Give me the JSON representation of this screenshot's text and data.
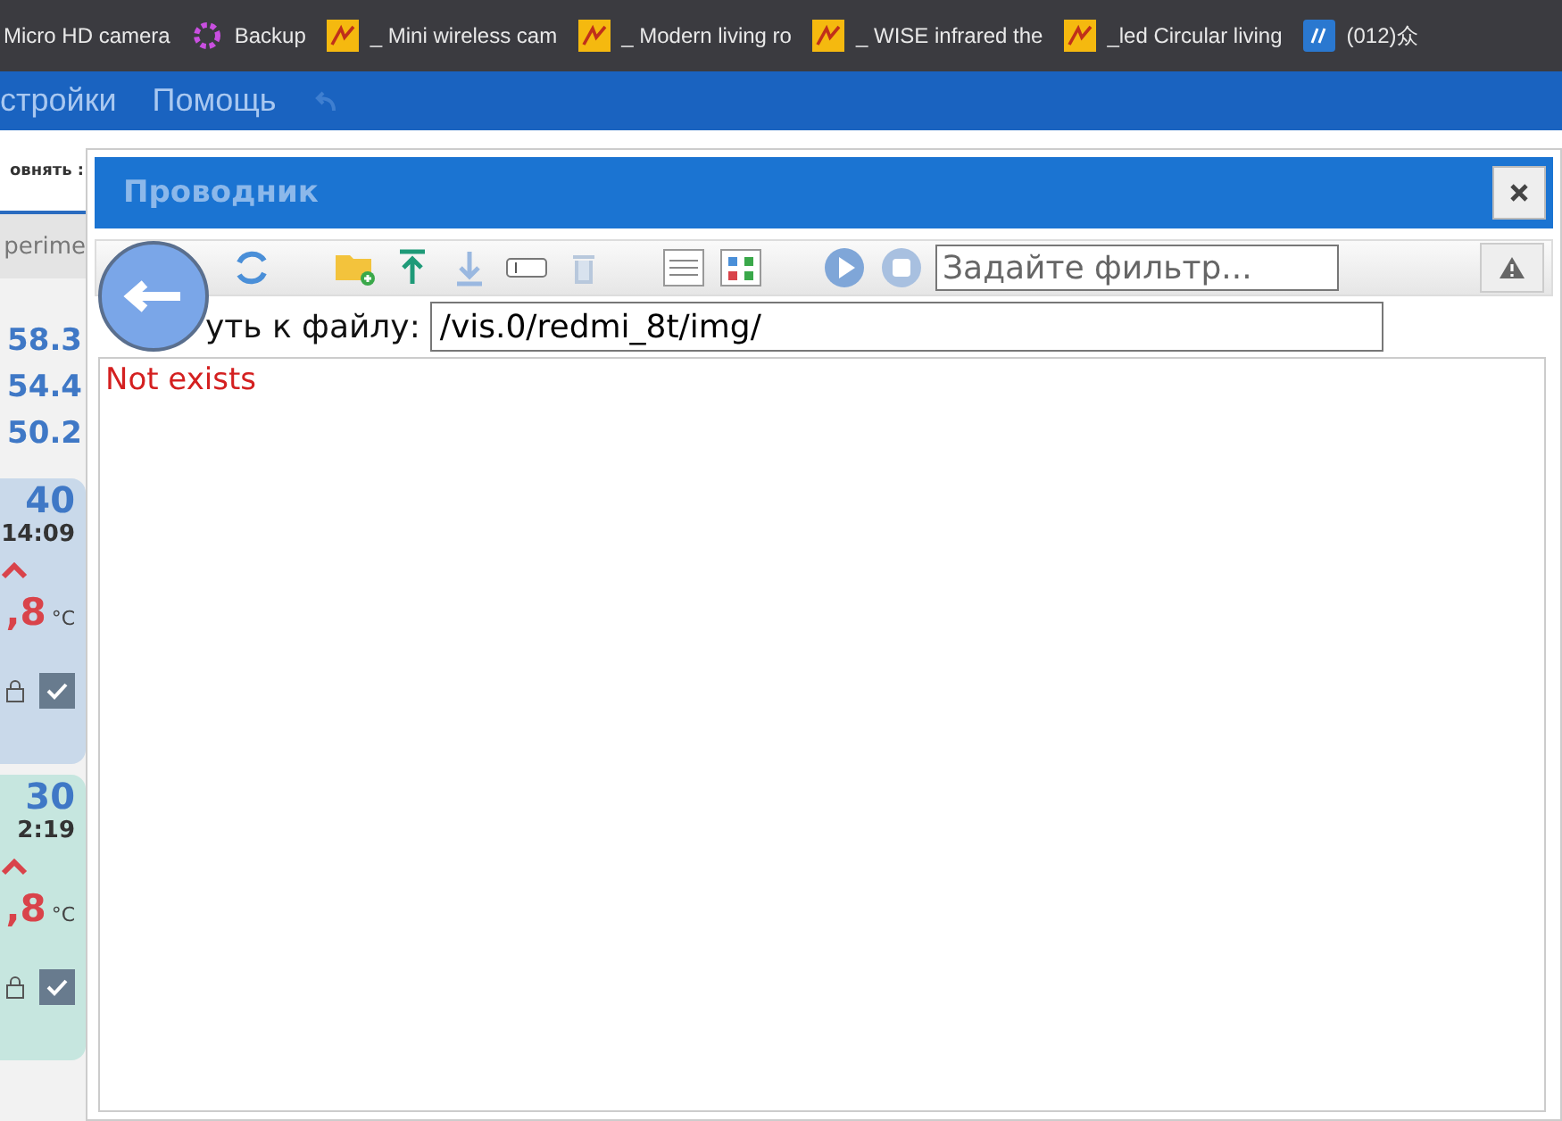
{
  "bookmarks": [
    {
      "label": "Micro HD camera"
    },
    {
      "label": "Backup"
    },
    {
      "label": "_ Mini wireless cam"
    },
    {
      "label": "_ Modern living ro"
    },
    {
      "label": "_ WISE infrared the"
    },
    {
      "label": "_led Circular living"
    },
    {
      "label": "(012)众"
    }
  ],
  "menu": [
    "стройки",
    "Помощь"
  ],
  "background": {
    "toolbar_text": "овнять :",
    "tab": "perime",
    "readings": [
      "58.3",
      "54.4",
      "50.2"
    ],
    "cards": [
      {
        "value": "40",
        "time": "14:09",
        "temp": ",8",
        "unit": "°C",
        "checked": true,
        "color": "#c9d9ea"
      },
      {
        "value": "30",
        "time": "2:19",
        "temp": ",8",
        "unit": "°C",
        "checked": true,
        "color": "#c6e6df"
      }
    ]
  },
  "dialog": {
    "title": "Проводник",
    "filter_placeholder": "Задайте фильтр...",
    "path_label": "уть к файлу:",
    "path": "/vis.0/redmi_8t/img/",
    "message": "Not exists"
  }
}
